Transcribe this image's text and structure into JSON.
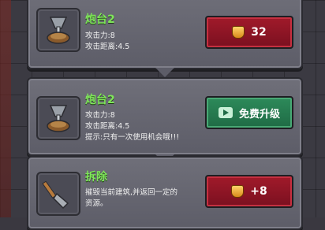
{
  "cards": [
    {
      "title": "炮台2",
      "lines": [
        "攻击力:8",
        "攻击距离:4.5"
      ],
      "button": {
        "type": "cost",
        "value": "32"
      }
    },
    {
      "title": "炮台2",
      "lines": [
        "攻击力:8",
        "攻击距离:4.5",
        "提示:只有一次使用机会哦!!!"
      ],
      "button": {
        "type": "free",
        "label": "免费升级"
      }
    },
    {
      "title": "拆除",
      "lines": [
        "摧毁当前建筑,并返回一定的",
        "资源。"
      ],
      "button": {
        "type": "refund",
        "value": "+8"
      }
    }
  ],
  "colors": {
    "title_green": "#7fe55a",
    "button_red": "#8f1525",
    "button_green": "#2a7f52"
  },
  "icons": [
    "turret-icon",
    "turret-icon",
    "shovel-icon",
    "gem-icon",
    "video-icon"
  ]
}
